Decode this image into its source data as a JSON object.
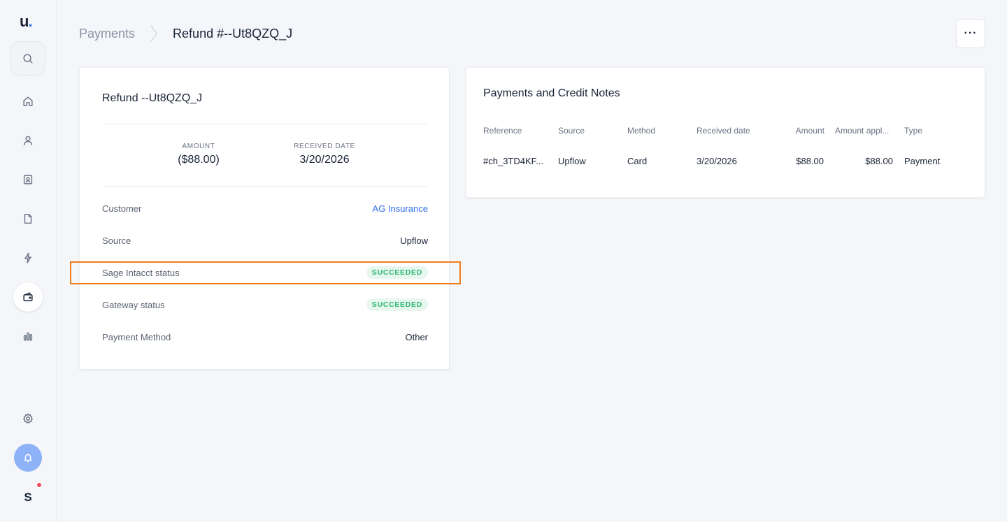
{
  "sidebar": {
    "logo_letter": "u",
    "logo_dot": ".",
    "avatar_initial": "S",
    "items": [
      {
        "icon": "search-icon"
      },
      {
        "icon": "home-icon"
      },
      {
        "icon": "user-icon"
      },
      {
        "icon": "contact-card-icon"
      },
      {
        "icon": "document-icon"
      },
      {
        "icon": "lightning-icon"
      },
      {
        "icon": "wallet-icon",
        "active": true
      },
      {
        "icon": "bar-chart-icon"
      },
      {
        "icon": "gear-icon"
      },
      {
        "icon": "bell-icon"
      }
    ]
  },
  "header": {
    "breadcrumb_parent": "Payments",
    "breadcrumb_current": "Refund #--Ut8QZQ_J",
    "more_label": "···"
  },
  "refund": {
    "title": "Refund --Ut8QZQ_J",
    "amount_label": "AMOUNT",
    "amount_value": "($88.00)",
    "date_label": "RECEIVED DATE",
    "date_value": "3/20/2026",
    "rows": [
      {
        "label": "Customer",
        "value": "AG Insurance"
      },
      {
        "label": "Source",
        "value": "Upflow"
      },
      {
        "label": "Sage Intacct status",
        "value": "SUCCEEDED"
      },
      {
        "label": "Gateway status",
        "value": "SUCCEEDED"
      },
      {
        "label": "Payment Method",
        "value": "Other"
      }
    ]
  },
  "payments_table": {
    "title": "Payments and Credit Notes",
    "columns": [
      "Reference",
      "Source",
      "Method",
      "Received date",
      "Amount",
      "Amount appl...",
      "Type"
    ],
    "rows": [
      [
        "#ch_3TD4KF...",
        "Upflow",
        "Card",
        "3/20/2026",
        "$88.00",
        "$88.00",
        "Payment"
      ]
    ]
  },
  "colors": {
    "accent": "#2f6fec",
    "success_text": "#2bb673",
    "success_bg": "#e7f7ee",
    "highlight": "#f07f1f"
  }
}
